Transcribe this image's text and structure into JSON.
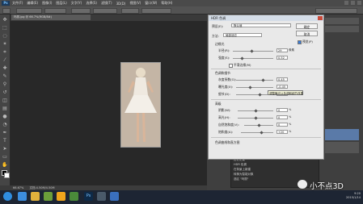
{
  "app": {
    "logo": "Ps",
    "menu": [
      "文件(F)",
      "编辑(E)",
      "图像(I)",
      "图层(L)",
      "文字(Y)",
      "选择(S)",
      "滤镜(T)",
      "3D(D)",
      "视图(V)",
      "窗口(W)",
      "帮助(H)"
    ],
    "doc_tab": "玛丽.jpg @ 66.7%(RGB/8#)",
    "zoom_status": "66.67%",
    "doc_status": "文档:4.50M/4.50M"
  },
  "dialog": {
    "title": "HDR 色调",
    "preset_label": "预设(E):",
    "preset_value": "默认值",
    "method_label": "方法:",
    "method_value": "局部适应",
    "ok": "确定",
    "cancel": "取消",
    "preview": "预览(P)",
    "edge_glow": {
      "header": "边缘光",
      "radius_label": "半径(R):",
      "radius_value": "29",
      "radius_unit": "像素",
      "strength_label": "强度(S):",
      "strength_value": "0.52",
      "smooth_edges": "平滑边缘(M)"
    },
    "tone_detail": {
      "header": "色调和细节",
      "gamma_label": "灰度系数(G):",
      "gamma_value": "0.45",
      "exposure_label": "曝光度(X):",
      "exposure_value": "-0.45",
      "detail_label": "细节(D):",
      "detail_value": "+30",
      "detail_unit": "%"
    },
    "advanced": {
      "header": "高级",
      "shadow_label": "阴影(W):",
      "shadow_value": "0",
      "highlight_label": "高光(H):",
      "highlight_value": "0",
      "vibrance_label": "自然饱和度(V):",
      "vibrance_value": "0",
      "saturation_label": "饱和度(A):",
      "saturation_value": "+20",
      "unit": "%"
    },
    "curve_header": "色调曲线和直方图",
    "tooltip": "调整曝光以色调和细节改善"
  },
  "history_panel": {
    "rows": [
      "历史记录",
      "HDR 色调",
      "在背景上新建",
      "转换为智能对象",
      "选区 \"玛丽\""
    ]
  },
  "tray": {
    "time": "9:20",
    "date": "2015/1/14"
  },
  "watermark": "小不点3D"
}
